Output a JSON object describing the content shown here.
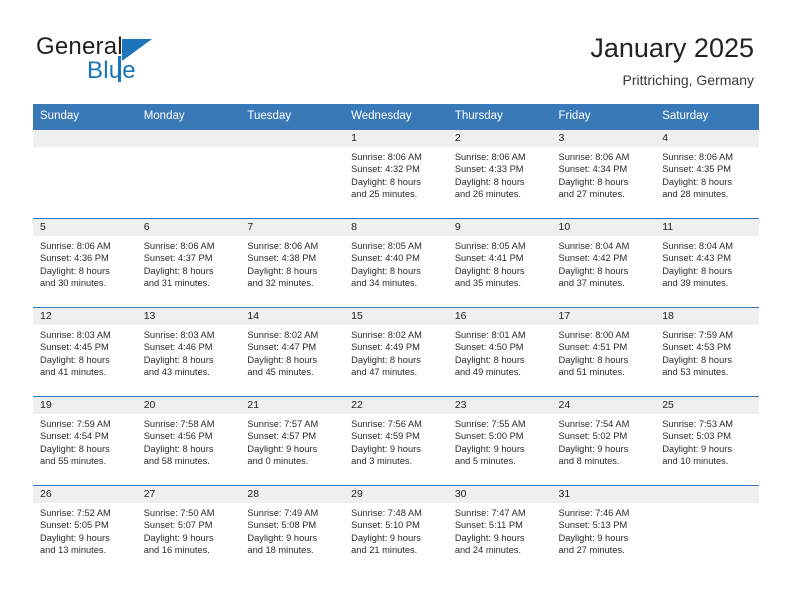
{
  "brand": {
    "name_part1": "General",
    "name_part2": "Blue",
    "accent_color": "#1b75bb"
  },
  "header": {
    "title": "January 2025",
    "location": "Prittriching, Germany",
    "header_bg_color": "#3a79b8"
  },
  "weekday_headers": [
    "Sunday",
    "Monday",
    "Tuesday",
    "Wednesday",
    "Thursday",
    "Friday",
    "Saturday"
  ],
  "labels": {
    "sunrise_prefix": "Sunrise:",
    "sunset_prefix": "Sunset:",
    "daylight_prefix": "Daylight:"
  },
  "weeks": [
    [
      {
        "day": "",
        "empty": true
      },
      {
        "day": "",
        "empty": true
      },
      {
        "day": "",
        "empty": true
      },
      {
        "day": "1",
        "sunrise": "Sunrise: 8:06 AM",
        "sunset": "Sunset: 4:32 PM",
        "daylight1": "Daylight: 8 hours",
        "daylight2": "and 25 minutes."
      },
      {
        "day": "2",
        "sunrise": "Sunrise: 8:06 AM",
        "sunset": "Sunset: 4:33 PM",
        "daylight1": "Daylight: 8 hours",
        "daylight2": "and 26 minutes."
      },
      {
        "day": "3",
        "sunrise": "Sunrise: 8:06 AM",
        "sunset": "Sunset: 4:34 PM",
        "daylight1": "Daylight: 8 hours",
        "daylight2": "and 27 minutes."
      },
      {
        "day": "4",
        "sunrise": "Sunrise: 8:06 AM",
        "sunset": "Sunset: 4:35 PM",
        "daylight1": "Daylight: 8 hours",
        "daylight2": "and 28 minutes."
      }
    ],
    [
      {
        "day": "5",
        "sunrise": "Sunrise: 8:06 AM",
        "sunset": "Sunset: 4:36 PM",
        "daylight1": "Daylight: 8 hours",
        "daylight2": "and 30 minutes."
      },
      {
        "day": "6",
        "sunrise": "Sunrise: 8:06 AM",
        "sunset": "Sunset: 4:37 PM",
        "daylight1": "Daylight: 8 hours",
        "daylight2": "and 31 minutes."
      },
      {
        "day": "7",
        "sunrise": "Sunrise: 8:06 AM",
        "sunset": "Sunset: 4:38 PM",
        "daylight1": "Daylight: 8 hours",
        "daylight2": "and 32 minutes."
      },
      {
        "day": "8",
        "sunrise": "Sunrise: 8:05 AM",
        "sunset": "Sunset: 4:40 PM",
        "daylight1": "Daylight: 8 hours",
        "daylight2": "and 34 minutes."
      },
      {
        "day": "9",
        "sunrise": "Sunrise: 8:05 AM",
        "sunset": "Sunset: 4:41 PM",
        "daylight1": "Daylight: 8 hours",
        "daylight2": "and 35 minutes."
      },
      {
        "day": "10",
        "sunrise": "Sunrise: 8:04 AM",
        "sunset": "Sunset: 4:42 PM",
        "daylight1": "Daylight: 8 hours",
        "daylight2": "and 37 minutes."
      },
      {
        "day": "11",
        "sunrise": "Sunrise: 8:04 AM",
        "sunset": "Sunset: 4:43 PM",
        "daylight1": "Daylight: 8 hours",
        "daylight2": "and 39 minutes."
      }
    ],
    [
      {
        "day": "12",
        "sunrise": "Sunrise: 8:03 AM",
        "sunset": "Sunset: 4:45 PM",
        "daylight1": "Daylight: 8 hours",
        "daylight2": "and 41 minutes."
      },
      {
        "day": "13",
        "sunrise": "Sunrise: 8:03 AM",
        "sunset": "Sunset: 4:46 PM",
        "daylight1": "Daylight: 8 hours",
        "daylight2": "and 43 minutes."
      },
      {
        "day": "14",
        "sunrise": "Sunrise: 8:02 AM",
        "sunset": "Sunset: 4:47 PM",
        "daylight1": "Daylight: 8 hours",
        "daylight2": "and 45 minutes."
      },
      {
        "day": "15",
        "sunrise": "Sunrise: 8:02 AM",
        "sunset": "Sunset: 4:49 PM",
        "daylight1": "Daylight: 8 hours",
        "daylight2": "and 47 minutes."
      },
      {
        "day": "16",
        "sunrise": "Sunrise: 8:01 AM",
        "sunset": "Sunset: 4:50 PM",
        "daylight1": "Daylight: 8 hours",
        "daylight2": "and 49 minutes."
      },
      {
        "day": "17",
        "sunrise": "Sunrise: 8:00 AM",
        "sunset": "Sunset: 4:51 PM",
        "daylight1": "Daylight: 8 hours",
        "daylight2": "and 51 minutes."
      },
      {
        "day": "18",
        "sunrise": "Sunrise: 7:59 AM",
        "sunset": "Sunset: 4:53 PM",
        "daylight1": "Daylight: 8 hours",
        "daylight2": "and 53 minutes."
      }
    ],
    [
      {
        "day": "19",
        "sunrise": "Sunrise: 7:59 AM",
        "sunset": "Sunset: 4:54 PM",
        "daylight1": "Daylight: 8 hours",
        "daylight2": "and 55 minutes."
      },
      {
        "day": "20",
        "sunrise": "Sunrise: 7:58 AM",
        "sunset": "Sunset: 4:56 PM",
        "daylight1": "Daylight: 8 hours",
        "daylight2": "and 58 minutes."
      },
      {
        "day": "21",
        "sunrise": "Sunrise: 7:57 AM",
        "sunset": "Sunset: 4:57 PM",
        "daylight1": "Daylight: 9 hours",
        "daylight2": "and 0 minutes."
      },
      {
        "day": "22",
        "sunrise": "Sunrise: 7:56 AM",
        "sunset": "Sunset: 4:59 PM",
        "daylight1": "Daylight: 9 hours",
        "daylight2": "and 3 minutes."
      },
      {
        "day": "23",
        "sunrise": "Sunrise: 7:55 AM",
        "sunset": "Sunset: 5:00 PM",
        "daylight1": "Daylight: 9 hours",
        "daylight2": "and 5 minutes."
      },
      {
        "day": "24",
        "sunrise": "Sunrise: 7:54 AM",
        "sunset": "Sunset: 5:02 PM",
        "daylight1": "Daylight: 9 hours",
        "daylight2": "and 8 minutes."
      },
      {
        "day": "25",
        "sunrise": "Sunrise: 7:53 AM",
        "sunset": "Sunset: 5:03 PM",
        "daylight1": "Daylight: 9 hours",
        "daylight2": "and 10 minutes."
      }
    ],
    [
      {
        "day": "26",
        "sunrise": "Sunrise: 7:52 AM",
        "sunset": "Sunset: 5:05 PM",
        "daylight1": "Daylight: 9 hours",
        "daylight2": "and 13 minutes."
      },
      {
        "day": "27",
        "sunrise": "Sunrise: 7:50 AM",
        "sunset": "Sunset: 5:07 PM",
        "daylight1": "Daylight: 9 hours",
        "daylight2": "and 16 minutes."
      },
      {
        "day": "28",
        "sunrise": "Sunrise: 7:49 AM",
        "sunset": "Sunset: 5:08 PM",
        "daylight1": "Daylight: 9 hours",
        "daylight2": "and 18 minutes."
      },
      {
        "day": "29",
        "sunrise": "Sunrise: 7:48 AM",
        "sunset": "Sunset: 5:10 PM",
        "daylight1": "Daylight: 9 hours",
        "daylight2": "and 21 minutes."
      },
      {
        "day": "30",
        "sunrise": "Sunrise: 7:47 AM",
        "sunset": "Sunset: 5:11 PM",
        "daylight1": "Daylight: 9 hours",
        "daylight2": "and 24 minutes."
      },
      {
        "day": "31",
        "sunrise": "Sunrise: 7:46 AM",
        "sunset": "Sunset: 5:13 PM",
        "daylight1": "Daylight: 9 hours",
        "daylight2": "and 27 minutes."
      },
      {
        "day": "",
        "empty": true
      }
    ]
  ]
}
